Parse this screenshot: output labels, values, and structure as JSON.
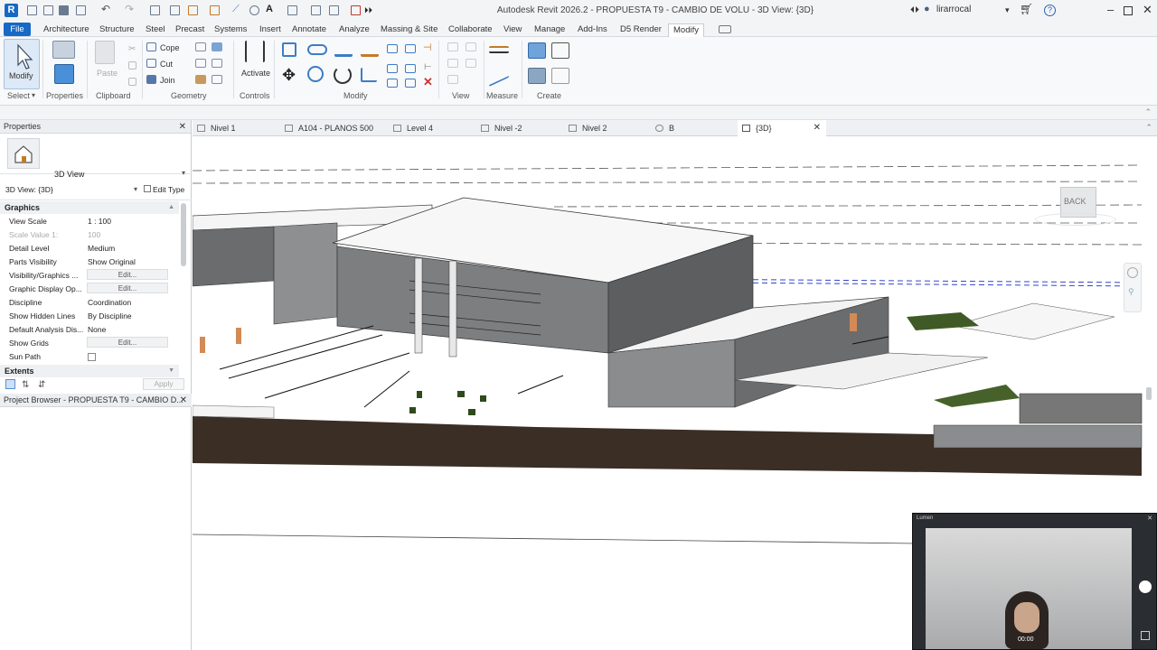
{
  "app": {
    "logo": "R",
    "title": "Autodesk Revit 2026.2 - PROPUESTA T9 - CAMBIO DE VOLU - 3D View: {3D}",
    "user": "lirarrocal"
  },
  "menu_tabs": [
    "File",
    "Architecture",
    "Structure",
    "Steel",
    "Precast",
    "Systems",
    "Insert",
    "Annotate",
    "Analyze",
    "Massing & Site",
    "Collaborate",
    "View",
    "Manage",
    "Add-Ins",
    "D5 Render",
    "Modify"
  ],
  "active_tab": "Modify",
  "ribbon": {
    "modify_label": "Modify",
    "select_label": "Select",
    "properties_label": "Properties",
    "clipboard_label": "Clipboard",
    "paste_label": "Paste",
    "geometry_label": "Geometry",
    "cope_label": "Cope",
    "cut_label": "Cut",
    "join_label": "Join",
    "controls_label": "Controls",
    "activate_label": "Activate",
    "modify_group_label": "Modify",
    "view_label": "View",
    "measure_label": "Measure",
    "create_label": "Create"
  },
  "properties": {
    "header": "Properties",
    "type_name": "3D View",
    "instance": "3D View: {3D}",
    "edit_type": "Edit Type",
    "graphics_header": "Graphics",
    "rows": [
      {
        "k": "View Scale",
        "v": "1 : 100"
      },
      {
        "k": "Scale Value   1:",
        "v": "100"
      },
      {
        "k": "Detail Level",
        "v": "Medium"
      },
      {
        "k": "Parts Visibility",
        "v": "Show Original"
      },
      {
        "k": "Visibility/Graphics ...",
        "v": "Edit..."
      },
      {
        "k": "Graphic Display Op...",
        "v": "Edit..."
      },
      {
        "k": "Discipline",
        "v": "Coordination"
      },
      {
        "k": "Show Hidden Lines",
        "v": "By Discipline"
      },
      {
        "k": "Default Analysis Dis...",
        "v": "None"
      },
      {
        "k": "Show Grids",
        "v": "Edit..."
      },
      {
        "k": "Sun Path",
        "v": ""
      }
    ],
    "extents_header": "Extents",
    "apply_label": "Apply",
    "browser_header": "Project Browser - PROPUESTA T9 - CAMBIO D..."
  },
  "view_tabs": [
    {
      "label": "Nivel 1"
    },
    {
      "label": "A104 - PLANOS 500"
    },
    {
      "label": "Level 4"
    },
    {
      "label": "Nivel -2"
    },
    {
      "label": "Nivel 2"
    },
    {
      "label": "B"
    },
    {
      "label": "{3D}"
    }
  ],
  "viewcube_label": "BACK",
  "webcam": {
    "title": "Lumen",
    "time": "00:00"
  }
}
